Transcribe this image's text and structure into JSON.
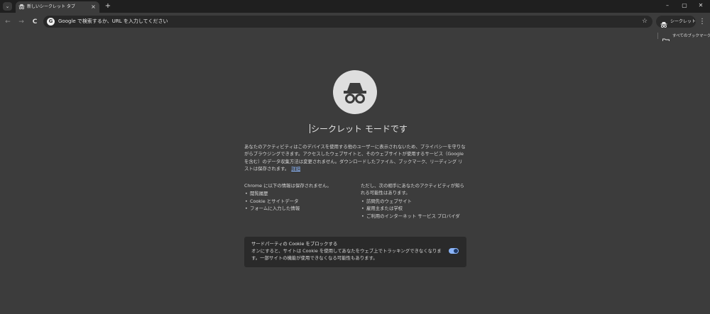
{
  "browser": {
    "tab": {
      "icon": "incognito-icon",
      "title": "新しいシークレット タブ",
      "close_glyph": "×"
    },
    "tab_search_glyph": "⌄",
    "new_tab_glyph": "+",
    "window": {
      "minimize": "–",
      "maximize": "▢",
      "close": "✕"
    },
    "nav": {
      "back": "←",
      "forward": "→",
      "reload": "C"
    },
    "omnibox": {
      "engine_icon": "G",
      "placeholder": "Google で検索するか、URL を入力してください"
    },
    "star_glyph": "☆",
    "incognito_chip_label": "シークレット",
    "menu_glyph": "⋮",
    "bookmarks": {
      "all_bookmarks_label": "すべてのブックマーク"
    }
  },
  "page": {
    "headline": "シークレット モードです",
    "description": "あなたのアクティビティはこのデバイスを使用する他のユーザーに表示されないため、プライバシーを守りながらブラウジングできます。アクセスしたウェブサイトと、そのウェブサイトが使用するサービス（Google を含む）のデータ収集方法は変更されません。ダウンロードしたファイル、ブックマーク、リーディング リストは保存されます。",
    "learn_more": "詳細",
    "not_saved": {
      "heading": "Chrome に以下の情報は保存されません。",
      "items": [
        "閲覧履歴",
        "Cookie とサイトデータ",
        "フォームに入力した情報"
      ]
    },
    "visible_to": {
      "heading": "ただし、次の相手にあなたのアクティビティが知られる可能性はあります。",
      "items": [
        "訪問先のウェブサイト",
        "雇用主または学校",
        "ご利用のインターネット サービス プロバイダ"
      ]
    },
    "cookie_card": {
      "title": "サードパーティの Cookie をブロックする",
      "description": "オンにすると、サイトは Cookie を使用してあなたをウェブ上でトラッキングできなくなります。一部サイトの機能が使用できなくなる可能性もあります。",
      "toggle_on": true
    }
  },
  "colors": {
    "accent": "#8ab4f8",
    "background": "#3c3c3c",
    "titlebar": "#1f1f1f"
  }
}
